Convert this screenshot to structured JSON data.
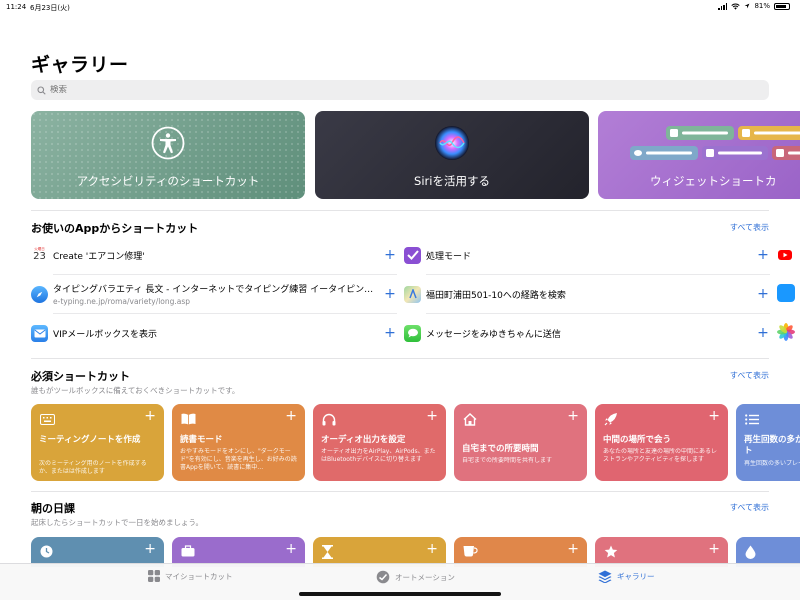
{
  "status_bar": {
    "time": "11:24",
    "date": "6月23日(火)",
    "battery": "81%",
    "battery_level": 0.81
  },
  "title": "ギャラリー",
  "search": {
    "placeholder": "検索"
  },
  "hero_cards": [
    {
      "label": "アクセシビリティのショートカット",
      "color": "#7aa693"
    },
    {
      "label": "Siriを活用する",
      "color": "#2b2b35"
    },
    {
      "label": "ウィジェットショートカ",
      "color": "#a56fcf"
    }
  ],
  "app_section": {
    "title": "お使いのAppからショートカット",
    "see_all": "すべて表示",
    "left": [
      {
        "icon": "calendar-icon",
        "date_top": "火曜日",
        "date_num": "23",
        "title": "Create 'エアコン修理'",
        "subtitle": ""
      },
      {
        "icon": "safari-icon",
        "title": "タイピングバラエティ 長文 - インターネットでタイピング練習 イータイピン…",
        "subtitle": "e-typing.ne.jp/roma/variety/long.asp"
      },
      {
        "icon": "mail-icon",
        "title": "VIPメールボックスを表示",
        "subtitle": ""
      }
    ],
    "right": [
      {
        "icon": "things-check-icon",
        "title": "処理モード"
      },
      {
        "icon": "maps-icon",
        "title": "福田町浦田501-10への経路を検索"
      },
      {
        "icon": "messages-icon",
        "title": "メッセージをみゆきちゃんに送信"
      }
    ]
  },
  "essentials": {
    "title": "必須ショートカット",
    "subtitle": "誰もがツールボックスに備えておくべきショートカットです。",
    "see_all": "すべて表示",
    "cards": [
      {
        "icon": "keyboard-icon",
        "title": "ミーティングノートを作成",
        "desc": "次のミーティング用のノートを作成するか、またはは作成します",
        "color": "#d9a43a"
      },
      {
        "icon": "book-icon",
        "title": "読書モード",
        "desc": "おやすみモードをオンにし、\"ダークモード\"を有効にし、音楽を再生し、お好みの読書Appを開いて、読書に集中…",
        "color": "#e08a45"
      },
      {
        "icon": "headphones-icon",
        "title": "オーディオ出力を設定",
        "desc": "オーディオ出力をAirPlay、AirPods、またはBluetoothデバイスに切り替えます",
        "color": "#e06a6a"
      },
      {
        "icon": "home-icon",
        "title": "自宅までの所要時間",
        "desc": "自宅までの所要時間を共有します",
        "color": "#e0727e"
      },
      {
        "icon": "rocket-icon",
        "title": "中間の場所で会う",
        "desc": "あなたの場所と友達の場所の中間にあるレストランやアクティビティを探します",
        "color": "#e06570"
      },
      {
        "icon": "list-icon",
        "title": "再生回数の多かったプレイリスト",
        "desc": "再生回数の多いプレイリス…",
        "color": "#6e8ed8"
      }
    ]
  },
  "morning": {
    "title": "朝の日課",
    "subtitle": "起床したらショートカットで一日を始めましょう。",
    "see_all": "すべて表示",
    "cards": [
      {
        "icon": "clock-icon",
        "color": "#5f8fb0"
      },
      {
        "icon": "briefcase-icon",
        "color": "#9a6ccc"
      },
      {
        "icon": "hourglass-icon",
        "color": "#d9a43a"
      },
      {
        "icon": "coffee-icon",
        "color": "#e0874a"
      },
      {
        "icon": "star-icon",
        "color": "#e0727e"
      },
      {
        "icon": "drop-icon",
        "color": "#6e8ed8"
      }
    ]
  },
  "tabs": [
    {
      "label": "マイショートカット",
      "icon": "grid-icon"
    },
    {
      "label": "オートメーション",
      "icon": "automation-icon"
    },
    {
      "label": "ギャラリー",
      "icon": "gallery-layers-icon",
      "active": true
    }
  ]
}
